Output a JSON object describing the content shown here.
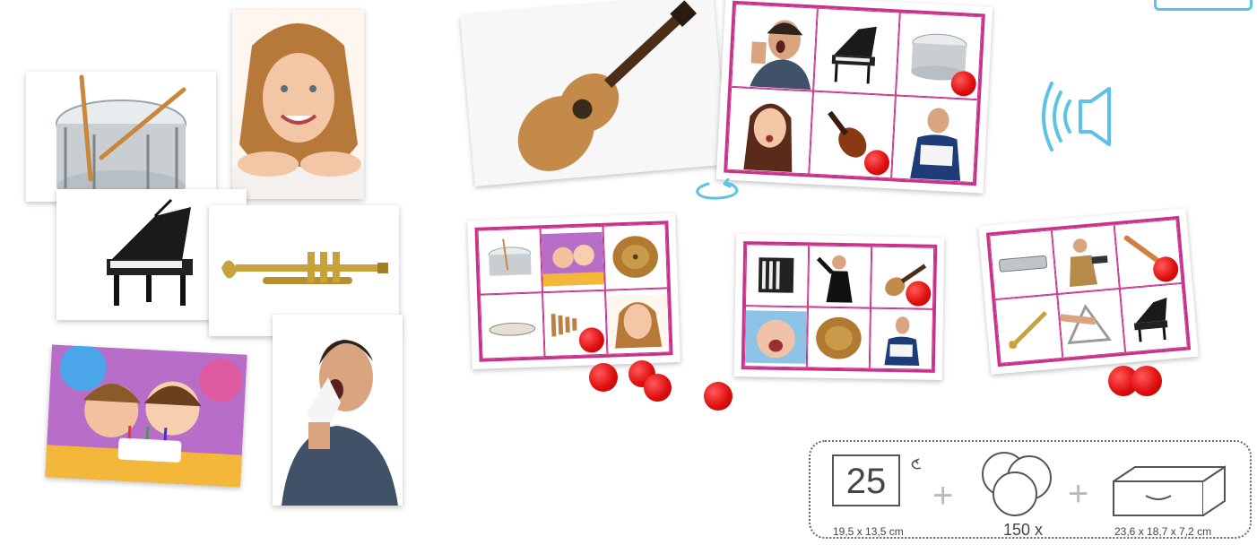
{
  "specs": {
    "card_count": "25",
    "card_size": "19,5 x 13,5 cm",
    "plus_1": "+",
    "token_count": "150 x",
    "plus_2": "+",
    "box_size": "23,6 x 18,7 x 7,2 cm"
  },
  "colors": {
    "board_border": "#c8308a",
    "token": "#e01010",
    "sound_icon": "#5bc3e6"
  },
  "icons": [
    "rotate-icon",
    "speaker-icon",
    "card-icon",
    "tokens-icon",
    "box-icon"
  ]
}
